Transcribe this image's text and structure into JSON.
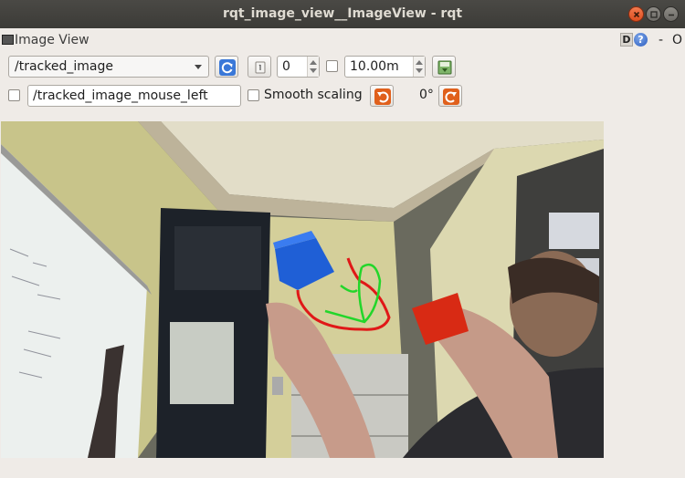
{
  "window": {
    "title": "rqt_image_view__ImageView - rqt"
  },
  "plugin": {
    "title": "Image View",
    "d_label": "D",
    "help_label": "?",
    "minimize_label": "-",
    "close_label": "O"
  },
  "toolbar": {
    "topic_value": "/tracked_image",
    "refresh_icon": "refresh-icon",
    "zoom_fit_icon": "zoom-1-icon",
    "spin_value": "0",
    "max_value": "10.00m",
    "save_icon": "save-image-icon",
    "mouse_topic_value": "/tracked_image_mouse_left",
    "smooth_scaling_label": "Smooth scaling",
    "rotate_left_icon": "rotate-left-icon",
    "rotation_value": "0°",
    "rotate_right_icon": "rotate-right-icon"
  },
  "colors": {
    "accent_blue": "#2a5cc0",
    "rotate_orange": "#e0601c",
    "trail_red": "#e01818",
    "trail_green": "#22d62a",
    "cube_blue": "#1f5fd6",
    "cube_red": "#d82a14"
  }
}
